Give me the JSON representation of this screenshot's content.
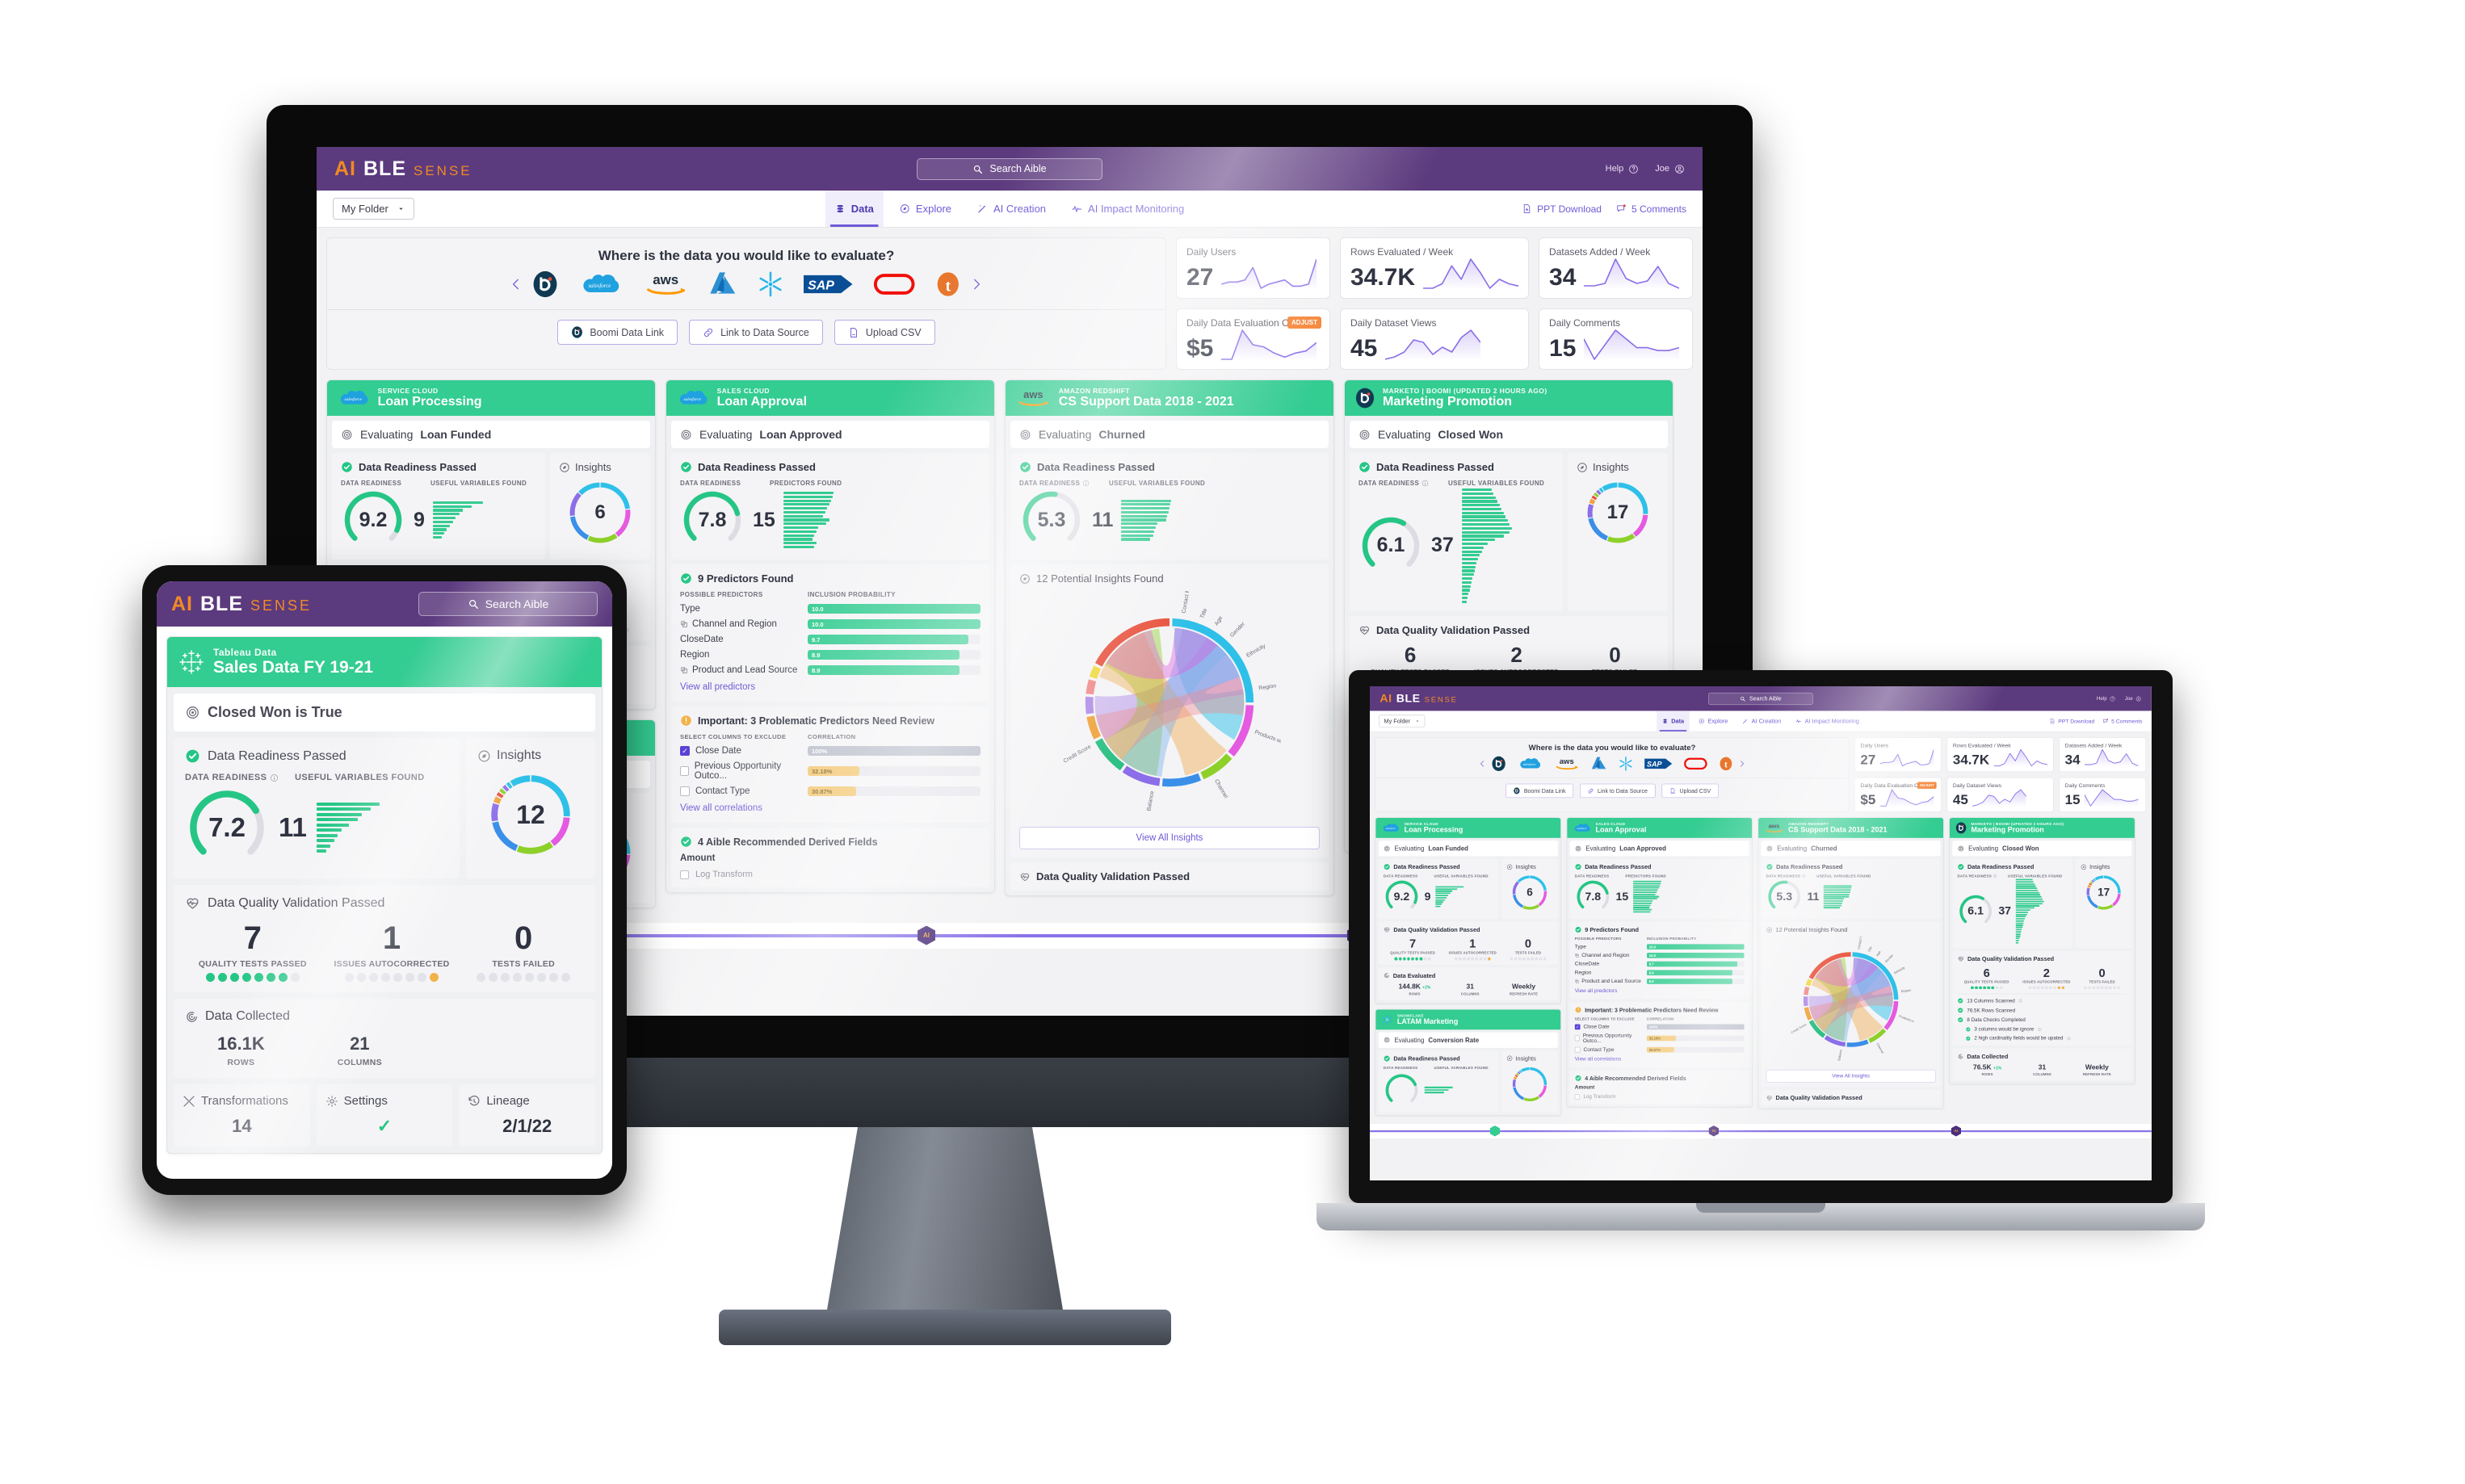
{
  "app": {
    "brand_a": "AI",
    "brand_b": "BLE",
    "brand_sense": "SENSE",
    "accent_purple": "#5c3a7e",
    "accent_orange": "#f08a24",
    "accent_green": "#33cc91",
    "accent_link": "#6f5ad6"
  },
  "header": {
    "search_placeholder": "Search Aible",
    "search_icon": "search-icon",
    "help_label": "Help",
    "help_icon": "question-circle-icon",
    "user_label": "Joe",
    "user_icon": "user-circle-icon"
  },
  "nav": {
    "folder_label": "My Folder",
    "folder_caret": "chevron-down-icon",
    "tabs": [
      {
        "label": "Data",
        "icon": "database-icon",
        "active": true
      },
      {
        "label": "Explore",
        "icon": "compass-icon",
        "active": false
      },
      {
        "label": "AI Creation",
        "icon": "magic-wand-icon",
        "active": false
      },
      {
        "label": "AI Impact Monitoring",
        "icon": "pulse-icon",
        "active": false
      }
    ],
    "right": [
      {
        "label": "PPT Download",
        "icon": "ppt-download-icon"
      },
      {
        "label": "5 Comments",
        "icon": "comment-icon"
      }
    ]
  },
  "source_panel": {
    "question": "Where is the data you would like to evaluate?",
    "prev_icon": "chevron-left-icon",
    "next_icon": "chevron-right-icon",
    "logos": [
      {
        "name": "boomi-logo",
        "label": "Boomi"
      },
      {
        "name": "salesforce-logo",
        "label": "salesforce"
      },
      {
        "name": "aws-logo",
        "label": "aws"
      },
      {
        "name": "azure-logo",
        "label": "Azure"
      },
      {
        "name": "snowflake-logo",
        "label": "Snowflake"
      },
      {
        "name": "sap-logo",
        "label": "SAP"
      },
      {
        "name": "oracle-logo",
        "label": "Oracle"
      },
      {
        "name": "tableau-logo",
        "label": "Tableau"
      }
    ],
    "buttons": [
      {
        "label": "Boomi Data Link",
        "icon": "boomi-icon"
      },
      {
        "label": "Link to Data Source",
        "icon": "link-icon"
      },
      {
        "label": "Upload CSV",
        "icon": "file-upload-icon"
      }
    ]
  },
  "kpis": [
    {
      "title": "Daily Users",
      "value": "27",
      "badge": null,
      "spark": [
        14,
        13,
        13,
        12,
        6,
        16,
        14,
        13,
        12,
        15,
        15,
        14,
        2
      ]
    },
    {
      "title": "Rows Evaluated / Week",
      "value": "34.7K",
      "badge": null,
      "spark": [
        16,
        16,
        14,
        6,
        12,
        3,
        9,
        16,
        12,
        14,
        15
      ]
    },
    {
      "title": "Datasets Added / Week",
      "value": "34",
      "badge": null,
      "spark": [
        15,
        15,
        14,
        4,
        12,
        14,
        13,
        7,
        14,
        16
      ]
    },
    {
      "title": "Daily Data Evaluation Costs",
      "value": "$5",
      "badge": "ADJUST",
      "spark": [
        16,
        16,
        2,
        9,
        10,
        13,
        15,
        13,
        12,
        8
      ]
    },
    {
      "title": "Daily Dataset Views",
      "value": "45",
      "badge": null,
      "spark": [
        15,
        14,
        12,
        7,
        8,
        13,
        10,
        12,
        6,
        3,
        8
      ]
    },
    {
      "title": "Daily Comments",
      "value": "15",
      "badge": null,
      "spark": [
        9,
        16,
        11,
        6,
        9,
        12,
        12,
        13,
        13,
        12
      ]
    }
  ],
  "cards": [
    {
      "source_icon": "salesforce-icon",
      "source": "SERVICE CLOUD",
      "title": "Loan Processing",
      "evaluating_prefix": "Evaluating",
      "evaluating_target": "Loan Funded",
      "target_icon": "target-icon",
      "readiness": {
        "heading": "Data Readiness Passed",
        "check_icon": "check-circle-icon",
        "score_label": "DATA READINESS",
        "score": "9.2",
        "vars_label": "USEFUL VARIABLES FOUND",
        "vars": "9",
        "funnel": [
          100,
          78,
          60,
          54,
          46,
          40,
          34,
          28,
          22,
          18
        ]
      },
      "insights": {
        "label": "Insights",
        "icon": "compass-icon",
        "count": "6"
      },
      "quality": {
        "heading": "Data Quality Validation Passed",
        "icon": "heartbeat-icon",
        "stats": [
          {
            "value": "7",
            "label": "QUALITY TESTS PASSED",
            "green": 7,
            "orange": 0,
            "total": 9
          },
          {
            "value": "1",
            "label": "ISSUES AUTOCORRECTED",
            "green": 0,
            "orange": 1,
            "total": 9
          },
          {
            "value": "0",
            "label": "TESTS FAILED",
            "green": 0,
            "orange": 0,
            "total": 9
          }
        ]
      },
      "collected": {
        "heading": "Data Evaluated",
        "icon": "target-rings-icon",
        "stats": [
          {
            "value": "144.8K",
            "delta": "+2%",
            "label": "ROWS"
          },
          {
            "value": "31",
            "delta": "",
            "label": "COLUMNS"
          },
          {
            "value": "Weekly",
            "delta": "",
            "label": "REFRESH RATE"
          }
        ]
      }
    },
    {
      "source_icon": "salesforce-icon",
      "source": "SALES CLOUD",
      "title": "Loan Approval",
      "evaluating_prefix": "Evaluating",
      "evaluating_target": "Loan Approved",
      "target_icon": "target-icon",
      "readiness": {
        "heading": "Data Readiness Passed",
        "check_icon": "check-circle-icon",
        "score_label": "DATA READINESS",
        "score": "7.8",
        "vars_label": "PREDICTORS FOUND",
        "vars": "15",
        "funnel": [
          100,
          98,
          95,
          92,
          88,
          84,
          80,
          92,
          86,
          70,
          66,
          62,
          58,
          66,
          62
        ]
      },
      "predictors": {
        "heading": "9 Predictors Found",
        "check_icon": "check-circle-icon",
        "col_name": "POSSIBLE PREDICTORS",
        "col_val": "INCLUSION PROBABILITY",
        "rows": [
          {
            "name": "Type",
            "value": "10.0",
            "pct": 100,
            "linked": false
          },
          {
            "name": "Channel and Region",
            "value": "10.0",
            "pct": 100,
            "linked": true
          },
          {
            "name": "CloseDate",
            "value": "9.7",
            "pct": 93,
            "linked": false
          },
          {
            "name": "Region",
            "value": "8.9",
            "pct": 88,
            "linked": false
          },
          {
            "name": "Product and Lead Source",
            "value": "8.9",
            "pct": 88,
            "linked": true
          }
        ],
        "link": "View all predictors"
      },
      "problematic": {
        "heading": "Important: 3 Problematic Predictors Need Review",
        "icon": "warning-icon",
        "col_name": "SELECT COLUMNS TO EXCLUDE",
        "col_val": "CORRELATION",
        "rows": [
          {
            "name": "Close Date",
            "value": "100%",
            "pct": 100,
            "checked": true,
            "style": "grey"
          },
          {
            "name": "Previous Opportunity Outco...",
            "value": "32.18%",
            "pct": 30,
            "checked": false,
            "style": "orange"
          },
          {
            "name": "Contact Type",
            "value": "30.87%",
            "pct": 28,
            "checked": false,
            "style": "orange"
          }
        ],
        "link": "View all correlations"
      },
      "derived": {
        "heading": "4 Aible Recommended Derived Fields",
        "check_icon": "check-circle-icon",
        "field": "Amount",
        "option": "Log Transform"
      }
    },
    {
      "source_icon": "aws-icon",
      "source": "AMAZON REDSHIFT",
      "title": "CS Support Data 2018 - 2021",
      "evaluating_prefix": "Evaluating",
      "evaluating_target": "Churned",
      "target_icon": "target-icon",
      "readiness": {
        "heading": "Data Readiness Passed",
        "check_icon": "check-circle-icon",
        "score_label": "DATA READINESS",
        "score": "5.3",
        "info_icon": "info-icon",
        "vars_label": "USEFUL VARIABLES FOUND",
        "vars": "11",
        "funnel": [
          100,
          98,
          96,
          94,
          92,
          90,
          72,
          68,
          66,
          64,
          58
        ]
      },
      "insights_panel": {
        "heading": "12 Potential Insights Found",
        "icon": "compass-icon",
        "chord_labels": [
          "Contact Method",
          "Title",
          "Age",
          "Gender",
          "Ethnicity",
          "Region",
          "Products with Bank",
          "Channel",
          "Balance",
          "Credit Score"
        ],
        "button": "View All Insights"
      },
      "quality_footer": {
        "heading": "Data Quality Validation Passed",
        "icon": "heartbeat-icon"
      }
    },
    {
      "source_icon": "boomi-icon",
      "source": "MARKETO | BOOMI (UPDATED 2 HOURS AGO)",
      "title": "Marketing Promotion",
      "evaluating_prefix": "Evaluating",
      "evaluating_target": "Closed Won",
      "target_icon": "target-icon",
      "readiness": {
        "heading": "Data Readiness Passed",
        "check_icon": "check-circle-icon",
        "score_label": "DATA READINESS",
        "score": "6.1",
        "info_icon": "info-icon",
        "vars_label": "USEFUL VARIABLES FOUND",
        "vars": "37",
        "funnel": [
          60,
          64,
          68,
          72,
          76,
          80,
          84,
          88,
          92,
          96,
          100,
          96,
          84,
          66,
          52,
          44,
          40,
          36,
          32,
          30,
          28,
          26,
          24,
          22,
          20,
          18,
          16,
          14,
          12,
          10
        ]
      },
      "insights": {
        "label": "Insights",
        "icon": "compass-icon",
        "count": "17"
      },
      "quality": {
        "heading": "Data Quality Validation Passed",
        "icon": "heartbeat-icon",
        "stats": [
          {
            "value": "6",
            "label": "QUALITY TESTS PASSED",
            "green": 6,
            "orange": 0,
            "total": 8
          },
          {
            "value": "2",
            "label": "ISSUES AUTOCORRECTED",
            "green": 0,
            "orange": 2,
            "total": 9
          },
          {
            "value": "0",
            "label": "TESTS FAILED",
            "green": 0,
            "orange": 0,
            "total": 9
          }
        ],
        "checks": [
          {
            "label": "13 Columns Scanned",
            "info": true,
            "sub": false
          },
          {
            "label": "76.5K Rows Scanned",
            "info": false,
            "sub": false
          },
          {
            "label": "8 Data Checks Completed",
            "info": false,
            "sub": false
          },
          {
            "label": "3 columns would be ignore",
            "info": true,
            "sub": true
          },
          {
            "label": "2 high cardinality fields would be upated",
            "info": true,
            "sub": true
          }
        ]
      },
      "collected": {
        "heading": "Data Collected",
        "icon": "target-rings-icon",
        "stats": [
          {
            "value": "76.5K",
            "delta": "+1%",
            "label": "ROWS"
          },
          {
            "value": "31",
            "delta": "",
            "label": "COLUMNS"
          },
          {
            "value": "Weekly",
            "delta": "",
            "label": "REFRESH RATE"
          }
        ]
      }
    }
  ],
  "second_row_card": {
    "source_icon": "snowflake-icon",
    "source": "SNOWFLAKE",
    "title": "LATAM Marketing",
    "evaluating_prefix": "Evaluating",
    "evaluating_target": "Conversion Rate",
    "readiness_heading": "Data Readiness Passed",
    "score_label": "DATA READINESS",
    "vars_label": "USEFUL VARIABLES FOUND",
    "insights_label": "Insights"
  },
  "timeline": {
    "markers": [
      {
        "name": "marker-green",
        "glyph": "",
        "pos": 16,
        "green": true
      },
      {
        "name": "marker-aible-1",
        "glyph": "AI",
        "pos": 44,
        "green": false
      },
      {
        "name": "marker-aible-2",
        "glyph": "AI",
        "pos": 75,
        "green": false
      }
    ]
  },
  "tablet": {
    "search_placeholder": "Search Aible",
    "card": {
      "source_icon": "tableau-icon",
      "source": "Tableau Data",
      "title": "Sales Data FY 19-21",
      "condition": "Closed Won is True",
      "condition_icon": "target-icon",
      "readiness": {
        "heading": "Data Readiness Passed",
        "score_label": "DATA READINESS",
        "info_icon": "info-icon",
        "score": "7.2",
        "vars_label": "USEFUL VARIABLES FOUND",
        "vars": "11",
        "funnel": [
          100,
          86,
          72,
          66,
          52,
          40,
          34,
          28,
          22,
          16
        ]
      },
      "insights": {
        "label": "Insights",
        "icon": "compass-icon",
        "count": "12"
      },
      "quality": {
        "heading": "Data Quality Validation Passed",
        "icon": "heartbeat-icon",
        "stats": [
          {
            "value": "7",
            "label": "QUALITY TESTS PASSED",
            "green": 7,
            "orange": 0,
            "total": 8
          },
          {
            "value": "1",
            "label": "ISSUES AUTOCORRECTED",
            "green": 0,
            "orange": 1,
            "total": 8
          },
          {
            "value": "0",
            "label": "TESTS FAILED",
            "green": 0,
            "orange": 0,
            "total": 8
          }
        ]
      },
      "collected": {
        "heading": "Data Collected",
        "icon": "target-rings-icon",
        "stats": [
          {
            "value": "16.1K",
            "label": "ROWS"
          },
          {
            "value": "21",
            "label": "COLUMNS"
          }
        ]
      },
      "footer_tabs": [
        {
          "label": "Transformations",
          "icon": "transform-icon",
          "value": "14"
        },
        {
          "label": "Settings",
          "icon": "gear-icon",
          "value": ""
        },
        {
          "label": "Lineage",
          "icon": "history-icon",
          "value": "2/1/22"
        }
      ]
    }
  },
  "chart_data": {
    "type": "line",
    "title": "KPI sparklines",
    "series": [
      {
        "name": "Daily Users",
        "value": 27
      },
      {
        "name": "Rows Evaluated / Week",
        "value": 34700
      },
      {
        "name": "Datasets Added / Week",
        "value": 34
      },
      {
        "name": "Daily Data Evaluation Costs",
        "value": 5
      },
      {
        "name": "Daily Dataset Views",
        "value": 45
      },
      {
        "name": "Daily Comments",
        "value": 15
      }
    ]
  }
}
